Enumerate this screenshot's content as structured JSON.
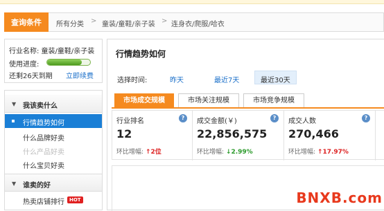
{
  "breadcrumb": {
    "query_button": "查询条件",
    "items": [
      "所有分类",
      "童装/童鞋/亲子装",
      "连身衣/爬服/哈衣"
    ],
    "separator": ">"
  },
  "shop_info": {
    "industry": "行业名称: 童装/童鞋/亲子装",
    "usage_label": "使用进度:",
    "usage_fraction": 0.8,
    "expiry": "还剩26天到期",
    "renew": "立即续费"
  },
  "menu": {
    "group1": "我该卖什么",
    "items1": [
      {
        "label": "行情趋势如何",
        "state": "active"
      },
      {
        "label": "什么品牌好卖",
        "state": "normal"
      },
      {
        "label": "什么产品好卖",
        "state": "disabled"
      },
      {
        "label": "什么宝贝好卖",
        "state": "normal"
      }
    ],
    "group2": "谁卖的好",
    "items2": [
      {
        "label": "热卖店铺排行",
        "badge": "HOT"
      }
    ]
  },
  "main": {
    "title": "行情趋势如何",
    "time_label": "选择时间:",
    "time_options": [
      "昨天",
      "最近7天",
      "最近30天"
    ],
    "selected_time": "最近30天",
    "tabs": [
      "市场成交规模",
      "市场关注规模",
      "市场竞争规模"
    ],
    "active_tab": "市场成交规模",
    "metrics": [
      {
        "label": "行业排名",
        "value": "12",
        "change_label": "环比增幅:",
        "arrow": "↑",
        "change": "2位",
        "direction": "up"
      },
      {
        "label": "成交金额(￥)",
        "value": "22,856,575",
        "change_label": "环比增幅:",
        "arrow": "↓",
        "change": "2.99%",
        "direction": "down"
      },
      {
        "label": "成交人数",
        "value": "270,466",
        "change_label": "环比增幅:",
        "arrow": "↑",
        "change": "17.97%",
        "direction": "up"
      }
    ]
  },
  "watermark": "BNXB.com",
  "colors": {
    "accent": "#f58a1f",
    "link": "#1a6fc9",
    "active_menu": "#1a7fd6",
    "up": "#dd2222",
    "down": "#2a9a2a"
  },
  "icons": {
    "question": "question-icon",
    "hot": "hot-badge"
  }
}
